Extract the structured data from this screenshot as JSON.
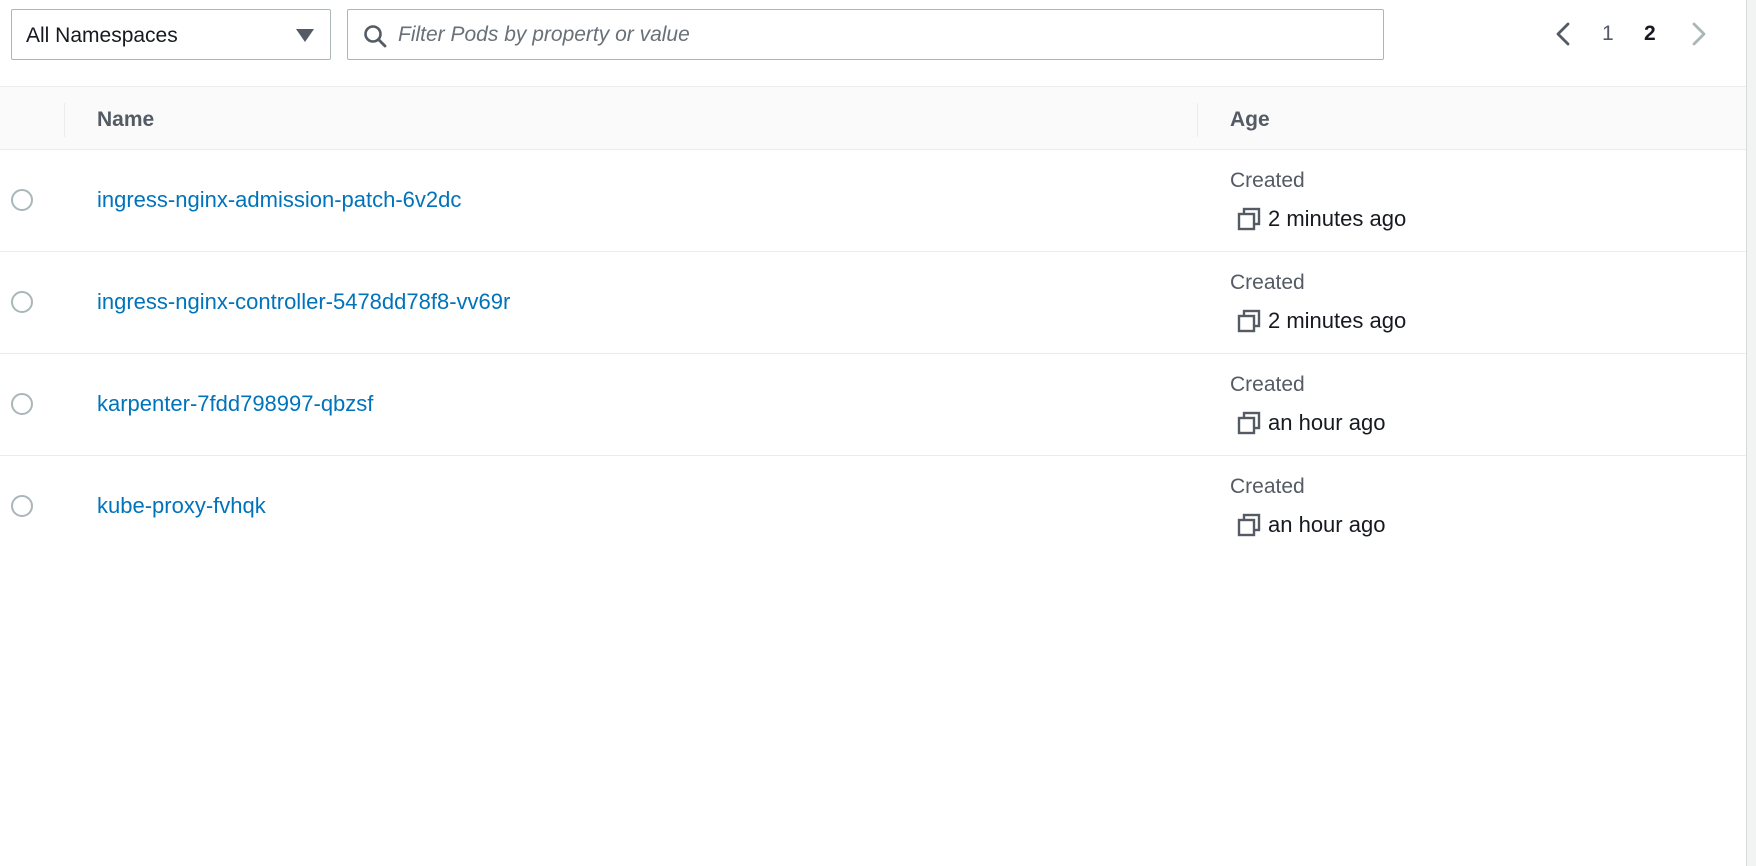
{
  "toolbar": {
    "namespace_select": {
      "value": "All Namespaces"
    },
    "filter": {
      "placeholder": "Filter Pods by property or value"
    },
    "pagination": {
      "pages": [
        "1",
        "2"
      ],
      "current": "2"
    }
  },
  "table": {
    "columns": {
      "name": "Name",
      "age": "Age"
    },
    "rows": [
      {
        "name": "ingress-nginx-admission-patch-6v2dc",
        "age_label": "Created",
        "age_value": "2 minutes ago"
      },
      {
        "name": "ingress-nginx-controller-5478dd78f8-vv69r",
        "age_label": "Created",
        "age_value": "2 minutes ago"
      },
      {
        "name": "karpenter-7fdd798997-qbzsf",
        "age_label": "Created",
        "age_value": "an hour ago"
      },
      {
        "name": "kube-proxy-fvhqk",
        "age_label": "Created",
        "age_value": "an hour ago"
      }
    ]
  },
  "colors": {
    "link": "#0073bb",
    "text": "#16191f",
    "muted": "#545b64",
    "border": "#aab7b8",
    "header_bg": "#fafafa"
  },
  "icons": [
    "caret-down-icon",
    "search-icon",
    "chevron-left-icon",
    "chevron-right-icon",
    "copy-icon"
  ]
}
